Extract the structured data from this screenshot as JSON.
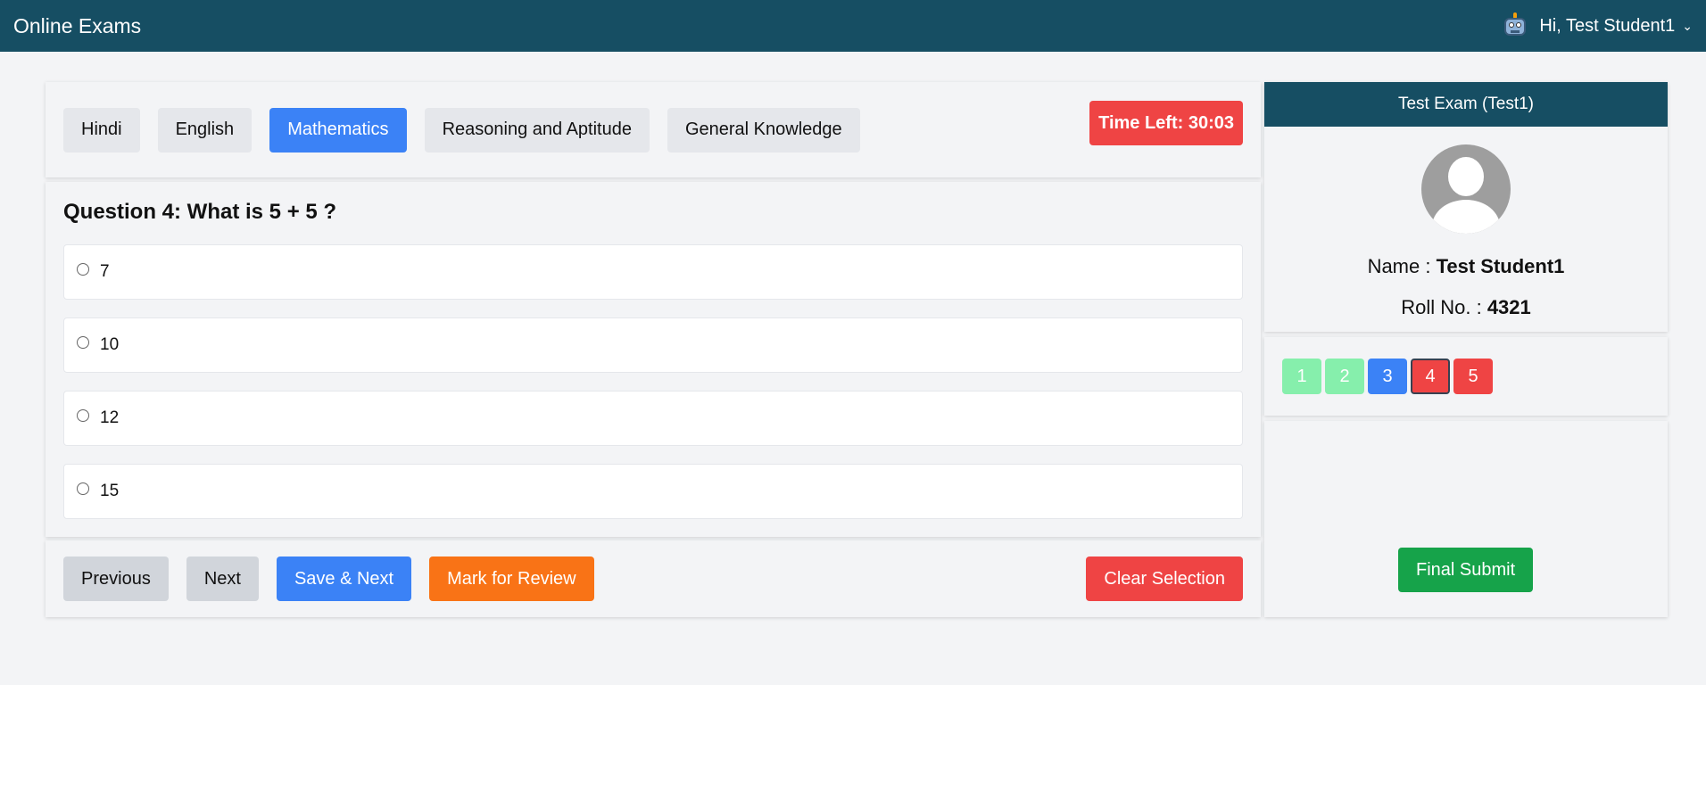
{
  "topbar": {
    "title": "Online Exams",
    "user_greeting": "Hi, Test Student1",
    "chevron": "⌄",
    "user_icon": "robot-avatar-icon"
  },
  "subjects": {
    "tabs": [
      {
        "label": "Hindi",
        "active": false
      },
      {
        "label": "English",
        "active": false
      },
      {
        "label": "Mathematics",
        "active": true
      },
      {
        "label": "Reasoning and Aptitude",
        "active": false
      },
      {
        "label": "General Knowledge",
        "active": false
      }
    ],
    "timer": "Time Left: 30:03"
  },
  "question": {
    "title": "Question 4: What is 5 + 5 ?",
    "options": [
      "7",
      "10",
      "12",
      "15"
    ]
  },
  "actions": {
    "previous": "Previous",
    "next": "Next",
    "save_next": "Save & Next",
    "mark_review": "Mark for Review",
    "clear": "Clear Selection"
  },
  "sidebar": {
    "exam_title": "Test Exam (Test1)",
    "name_label": "Name : ",
    "name_value": "Test Student1",
    "roll_label": "Roll No. : ",
    "roll_value": "4321",
    "questions": [
      {
        "num": "1",
        "status": "answered"
      },
      {
        "num": "2",
        "status": "answered"
      },
      {
        "num": "3",
        "status": "current-blue"
      },
      {
        "num": "4",
        "status": "red",
        "selected": true
      },
      {
        "num": "5",
        "status": "red"
      }
    ],
    "final_submit": "Final Submit"
  },
  "colors": {
    "header": "#164e63",
    "active_tab": "#3b82f6",
    "timer": "#ef4444",
    "answered": "#86efac",
    "review": "#f97316",
    "submit": "#16a34a"
  }
}
